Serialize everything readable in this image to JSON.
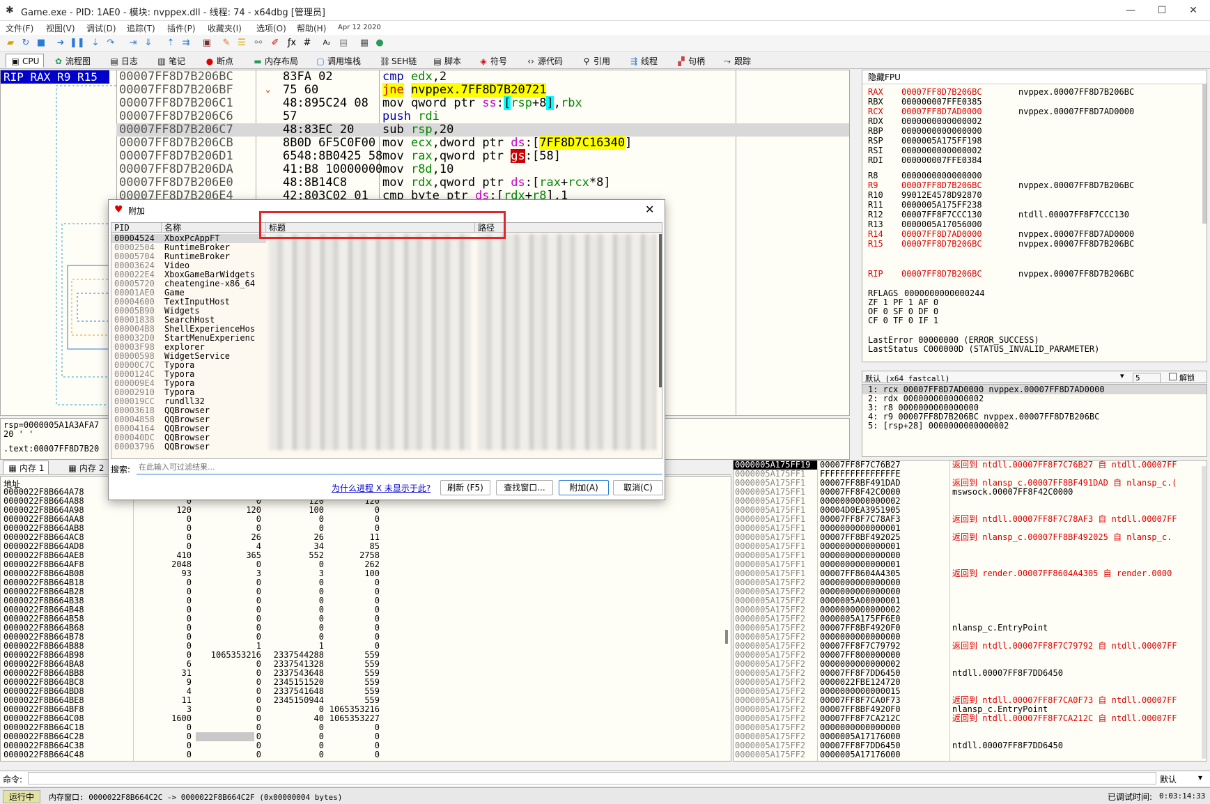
{
  "window": {
    "title": "Game.exe - PID: 1AE0 - 模块: nvppex.dll - 线程: 74 - x64dbg [管理员]"
  },
  "menu": [
    "文件(F)",
    "视图(V)",
    "调试(D)",
    "追踪(T)",
    "插件(P)",
    "收藏夹(I)",
    "选项(O)",
    "帮助(H)",
    "Apr 12 2020"
  ],
  "tabs": [
    {
      "label": "CPU",
      "icon": "cpu-icon"
    },
    {
      "label": "流程图",
      "icon": "graph-icon"
    },
    {
      "label": "日志",
      "icon": "log-icon"
    },
    {
      "label": "笔记",
      "icon": "notes-icon"
    },
    {
      "label": "断点",
      "icon": "breakpoint-icon"
    },
    {
      "label": "内存布局",
      "icon": "memory-map-icon"
    },
    {
      "label": "调用堆栈",
      "icon": "callstack-icon"
    },
    {
      "label": "SEH链",
      "icon": "seh-icon"
    },
    {
      "label": "脚本",
      "icon": "script-icon"
    },
    {
      "label": "符号",
      "icon": "symbols-icon"
    },
    {
      "label": "源代码",
      "icon": "source-icon"
    },
    {
      "label": "引用",
      "icon": "references-icon"
    },
    {
      "label": "线程",
      "icon": "threads-icon"
    },
    {
      "label": "句柄",
      "icon": "handles-icon"
    },
    {
      "label": "跟踪",
      "icon": "trace-icon"
    }
  ],
  "disasm": {
    "rip_label": "RIP RAX R9 R15",
    "lines": [
      {
        "addr": "00007FF8D7B206BC",
        "bytes": "83FA 02",
        "instr": "cmp edx,2"
      },
      {
        "addr": "00007FF8D7B206BF",
        "bytes": "75 60",
        "instr": "jne nvppex.7FF8D7B20721"
      },
      {
        "addr": "00007FF8D7B206C1",
        "bytes": "48:895C24 08",
        "instr": "mov qword ptr ss:[rsp+8],rbx"
      },
      {
        "addr": "00007FF8D7B206C6",
        "bytes": "57",
        "instr": "push rdi"
      },
      {
        "addr": "00007FF8D7B206C7",
        "bytes": "48:83EC 20",
        "instr": "sub rsp,20"
      },
      {
        "addr": "00007FF8D7B206CB",
        "bytes": "8B0D 6F5C0F00",
        "instr": "mov ecx,dword ptr ds:[7FF8D7C16340]"
      },
      {
        "addr": "00007FF8D7B206D1",
        "bytes": "6548:8B0425 58",
        "instr": "mov rax,qword ptr gs:[58]"
      },
      {
        "addr": "00007FF8D7B206DA",
        "bytes": "41:B8 10000000",
        "instr": "mov r8d,10"
      },
      {
        "addr": "00007FF8D7B206E0",
        "bytes": "48:8B14C8",
        "instr": "mov rdx,qword ptr ds:[rax+rcx*8]"
      },
      {
        "addr": "00007FF8D7B206E4",
        "bytes": "42:803C02 01",
        "instr": "cmp byte ptr ds:[rdx+r8],1"
      }
    ]
  },
  "info": {
    "line1": "rsp=0000005A1A3AFA7",
    "line2": "20 '  '",
    "line3": ".text:00007FF8D7B20"
  },
  "registers": {
    "header": "隐藏FPU",
    "gpr": [
      {
        "name": "RAX",
        "value": "00007FF8D7B206BC",
        "comment": "nvppex.00007FF8D7B206BC",
        "changed": true
      },
      {
        "name": "RBX",
        "value": "000000007FFE0385",
        "comment": "",
        "changed": false
      },
      {
        "name": "RCX",
        "value": "00007FF8D7AD0000",
        "comment": "nvppex.00007FF8D7AD0000",
        "changed": true
      },
      {
        "name": "RDX",
        "value": "0000000000000002",
        "comment": "",
        "changed": false
      },
      {
        "name": "RBP",
        "value": "0000000000000000",
        "comment": "",
        "changed": false
      },
      {
        "name": "RSP",
        "value": "0000005A175FF198",
        "comment": "",
        "changed": false
      },
      {
        "name": "RSI",
        "value": "0000000000000002",
        "comment": "",
        "changed": false
      },
      {
        "name": "RDI",
        "value": "000000007FFE0384",
        "comment": "",
        "changed": false
      }
    ],
    "rx": [
      {
        "name": "R8",
        "value": "0000000000000000",
        "comment": "",
        "changed": false
      },
      {
        "name": "R9",
        "value": "00007FF8D7B206BC",
        "comment": "nvppex.00007FF8D7B206BC",
        "changed": true
      },
      {
        "name": "R10",
        "value": "99012E4578D92870",
        "comment": "",
        "changed": false
      },
      {
        "name": "R11",
        "value": "0000005A175FF238",
        "comment": "",
        "changed": false
      },
      {
        "name": "R12",
        "value": "00007FF8F7CCC130",
        "comment": "ntdll.00007FF8F7CCC130",
        "changed": false
      },
      {
        "name": "R13",
        "value": "0000005A17056000",
        "comment": "",
        "changed": false
      },
      {
        "name": "R14",
        "value": "00007FF8D7AD0000",
        "comment": "nvppex.00007FF8D7AD0000",
        "changed": true
      },
      {
        "name": "R15",
        "value": "00007FF8D7B206BC",
        "comment": "nvppex.00007FF8D7B206BC",
        "changed": true
      }
    ],
    "rip": {
      "name": "RIP",
      "value": "00007FF8D7B206BC",
      "comment": "nvppex.00007FF8D7B206BC"
    },
    "rflags": {
      "name": "RFLAGS",
      "value": "0000000000000244"
    },
    "flags_line1": "ZF 1   PF 1   AF 0",
    "flags_line2": "OF 0   SF 0   DF 0",
    "flags_line3": "CF 0   TF 0   IF 1",
    "lasterror": "LastError   00000000 (ERROR_SUCCESS)",
    "laststatus": "LastStatus  C000000D (STATUS_INVALID_PARAMETER)"
  },
  "args": {
    "convention": "默认 (x64 fastcall)",
    "count": "5",
    "unlock_label": "解锁",
    "lines": [
      "1: rcx 00007FF8D7AD0000 nvppex.00007FF8D7AD0000",
      "2: rdx 0000000000000002",
      "3: r8 0000000000000000",
      "4: r9 00007FF8D7B206BC nvppex.00007FF8D7B206BC",
      "5: [rsp+28] 0000000000000002"
    ]
  },
  "dump": {
    "tabs": [
      "内存 1",
      "内存 2"
    ],
    "col_addr": "地址",
    "rows": [
      [
        "0000022F8B664A78",
        "",
        "",
        "",
        ""
      ],
      [
        "0000022F8B664A88",
        "0",
        "0",
        "120",
        "120"
      ],
      [
        "0000022F8B664A98",
        "120",
        "120",
        "100",
        "0"
      ],
      [
        "0000022F8B664AA8",
        "0",
        "0",
        "0",
        "0"
      ],
      [
        "0000022F8B664AB8",
        "0",
        "0",
        "0",
        "0"
      ],
      [
        "0000022F8B664AC8",
        "0",
        "26",
        "26",
        "11"
      ],
      [
        "0000022F8B664AD8",
        "0",
        "4",
        "34",
        "85"
      ],
      [
        "0000022F8B664AE8",
        "410",
        "365",
        "552",
        "2758"
      ],
      [
        "0000022F8B664AF8",
        "2048",
        "0",
        "0",
        "262"
      ],
      [
        "0000022F8B664B08",
        "93",
        "3",
        "3",
        "100"
      ],
      [
        "0000022F8B664B18",
        "0",
        "0",
        "0",
        "0"
      ],
      [
        "0000022F8B664B28",
        "0",
        "0",
        "0",
        "0"
      ],
      [
        "0000022F8B664B38",
        "0",
        "0",
        "0",
        "0"
      ],
      [
        "0000022F8B664B48",
        "0",
        "0",
        "0",
        "0"
      ],
      [
        "0000022F8B664B58",
        "0",
        "0",
        "0",
        "0"
      ],
      [
        "0000022F8B664B68",
        "0",
        "0",
        "0",
        "0"
      ],
      [
        "0000022F8B664B78",
        "0",
        "0",
        "0",
        "0"
      ],
      [
        "0000022F8B664B88",
        "0",
        "1",
        "1",
        "0"
      ],
      [
        "0000022F8B664B98",
        "0",
        "1065353216",
        "2337544288",
        "559"
      ],
      [
        "0000022F8B664BA8",
        "6",
        "0",
        "2337541328",
        "559"
      ],
      [
        "0000022F8B664BB8",
        "31",
        "0",
        "2337543648",
        "559"
      ],
      [
        "0000022F8B664BC8",
        "9",
        "0",
        "2345151520",
        "559"
      ],
      [
        "0000022F8B664BD8",
        "4",
        "0",
        "2337541648",
        "559"
      ],
      [
        "0000022F8B664BE8",
        "11",
        "0",
        "2345150944",
        "559"
      ],
      [
        "0000022F8B664BF8",
        "3",
        "0",
        "0",
        "1065353216"
      ],
      [
        "0000022F8B664C08",
        "1600",
        "0",
        "40",
        "1065353227"
      ],
      [
        "0000022F8B664C18",
        "0",
        "0",
        "0",
        "0"
      ],
      [
        "0000022F8B664C28",
        "0",
        "0",
        "0",
        "0"
      ],
      [
        "0000022F8B664C38",
        "0",
        "0",
        "0",
        "0"
      ],
      [
        "0000022F8B664C48",
        "0",
        "0",
        "0",
        "0"
      ]
    ]
  },
  "stack": {
    "rows": [
      [
        "0000005A175FF19",
        "00007FF8F7C76B27",
        "返回到 ntdll.00007FF8F7C76B27 自 ntdll.00007FF"
      ],
      [
        "0000005A175FF1",
        "FFFFFFFFFFFFFFFE",
        ""
      ],
      [
        "0000005A175FF1",
        "00007FF8BF491DAD",
        "返回到 nlansp_c.00007FF8BF491DAD 自 nlansp_c.("
      ],
      [
        "0000005A175FF1",
        "00007FF8F42C0000",
        "mswsock.00007FF8F42C0000"
      ],
      [
        "0000005A175FF1",
        "0000000000000002",
        ""
      ],
      [
        "0000005A175FF1",
        "00004D0EA3951905",
        ""
      ],
      [
        "0000005A175FF1",
        "00007FF8F7C78AF3",
        "返回到 ntdll.00007FF8F7C78AF3 自 ntdll.00007FF"
      ],
      [
        "0000005A175FF1",
        "0000000000000001",
        ""
      ],
      [
        "0000005A175FF1",
        "00007FF8BF492025",
        "返回到 nlansp_c.00007FF8BF492025 自 nlansp_c."
      ],
      [
        "0000005A175FF1",
        "0000000000000001",
        ""
      ],
      [
        "0000005A175FF1",
        "0000000000000000",
        ""
      ],
      [
        "0000005A175FF1",
        "0000000000000001",
        ""
      ],
      [
        "0000005A175FF1",
        "00007FF8604A4305",
        "返回到 render.00007FF8604A4305 自 render.0000"
      ],
      [
        "0000005A175FF2",
        "0000000000000000",
        ""
      ],
      [
        "0000005A175FF2",
        "0000000000000000",
        ""
      ],
      [
        "0000005A175FF2",
        "0000005A00000001",
        ""
      ],
      [
        "0000005A175FF2",
        "0000000000000002",
        ""
      ],
      [
        "0000005A175FF2",
        "0000005A175FF6E0",
        ""
      ],
      [
        "0000005A175FF2",
        "00007FF8BF4920F0",
        "nlansp_c.EntryPoint"
      ],
      [
        "0000005A175FF2",
        "0000000000000000",
        ""
      ],
      [
        "0000005A175FF2",
        "00007FF8F7C79792",
        "返回到 ntdll.00007FF8F7C79792 自 ntdll.00007FF"
      ],
      [
        "0000005A175FF2",
        "00007FF800000000",
        ""
      ],
      [
        "0000005A175FF2",
        "0000000000000002",
        ""
      ],
      [
        "0000005A175FF2",
        "00007FF8F7DD6450",
        "ntdll.00007FF8F7DD6450"
      ],
      [
        "0000005A175FF2",
        "0000022FBE124720",
        ""
      ],
      [
        "0000005A175FF2",
        "0000000000000015",
        ""
      ],
      [
        "0000005A175FF2",
        "00007FF8F7CA0F73",
        "返回到 ntdll.00007FF8F7CA0F73 自 ntdll.00007FF"
      ],
      [
        "0000005A175FF2",
        "00007FF8BF4920F0",
        "nlansp_c.EntryPoint"
      ],
      [
        "0000005A175FF2",
        "00007FF8F7CA212C",
        "返回到 ntdll.00007FF8F7CA212C 自 ntdll.00007FF"
      ],
      [
        "0000005A175FF2",
        "0000000000000000",
        ""
      ],
      [
        "0000005A175FF2",
        "0000005A17176000",
        ""
      ],
      [
        "0000005A175FF2",
        "00007FF8F7DD6450",
        "ntdll.00007FF8F7DD6450"
      ],
      [
        "0000005A175FF2",
        "0000005A17176000",
        ""
      ]
    ]
  },
  "command": {
    "label": "命令:",
    "value": "",
    "mode": "默认"
  },
  "status": {
    "state": "运行中",
    "message": "内存窗口: 0000022F8B664C2C -> 0000022F8B664C2F (0x00000004 bytes)",
    "timer_label": "已调试时间:",
    "timer": "0:03:14:33"
  },
  "dialog": {
    "title": "附加",
    "col_pid": "PID",
    "col_name": "名称",
    "col_title": "标题",
    "col_path": "路径",
    "processes": [
      {
        "pid": "00004524",
        "name": "XboxPcAppFT"
      },
      {
        "pid": "00002504",
        "name": "RuntimeBroker"
      },
      {
        "pid": "00005704",
        "name": "RuntimeBroker"
      },
      {
        "pid": "00003624",
        "name": "Video"
      },
      {
        "pid": "000022E4",
        "name": "XboxGameBarWidgets"
      },
      {
        "pid": "00005720",
        "name": "cheatengine-x86_64"
      },
      {
        "pid": "00001AE0",
        "name": "Game"
      },
      {
        "pid": "00004600",
        "name": "TextInputHost"
      },
      {
        "pid": "00005B90",
        "name": "Widgets"
      },
      {
        "pid": "00001838",
        "name": "SearchHost"
      },
      {
        "pid": "000004B8",
        "name": "ShellExperienceHos"
      },
      {
        "pid": "000032D0",
        "name": "StartMenuExperienc"
      },
      {
        "pid": "00003F98",
        "name": "explorer"
      },
      {
        "pid": "00000598",
        "name": "WidgetService"
      },
      {
        "pid": "00000C7C",
        "name": "Typora"
      },
      {
        "pid": "0000124C",
        "name": "Typora"
      },
      {
        "pid": "000009E4",
        "name": "Typora"
      },
      {
        "pid": "00002910",
        "name": "Typora"
      },
      {
        "pid": "000019CC",
        "name": "rundll32"
      },
      {
        "pid": "00003618",
        "name": "QQBrowser"
      },
      {
        "pid": "00004858",
        "name": "QQBrowser"
      },
      {
        "pid": "00004164",
        "name": "QQBrowser"
      },
      {
        "pid": "000040DC",
        "name": "QQBrowser"
      },
      {
        "pid": "00003796",
        "name": "QQBrowser"
      }
    ],
    "search_label": "搜索:",
    "search_placeholder": "在此输入可过滤结果...",
    "why_link": "为什么进程 X 未显示于此?",
    "refresh_btn": "刷新 (F5)",
    "find_window_btn": "查找窗口...",
    "attach_btn": "附加(A)",
    "cancel_btn": "取消(C)"
  },
  "colors": {
    "accent_red": "#d00000",
    "highlight_yellow": "#ffff00",
    "rip_bar": "#0000cc",
    "dialog_highlight_border": "#e0282b"
  }
}
